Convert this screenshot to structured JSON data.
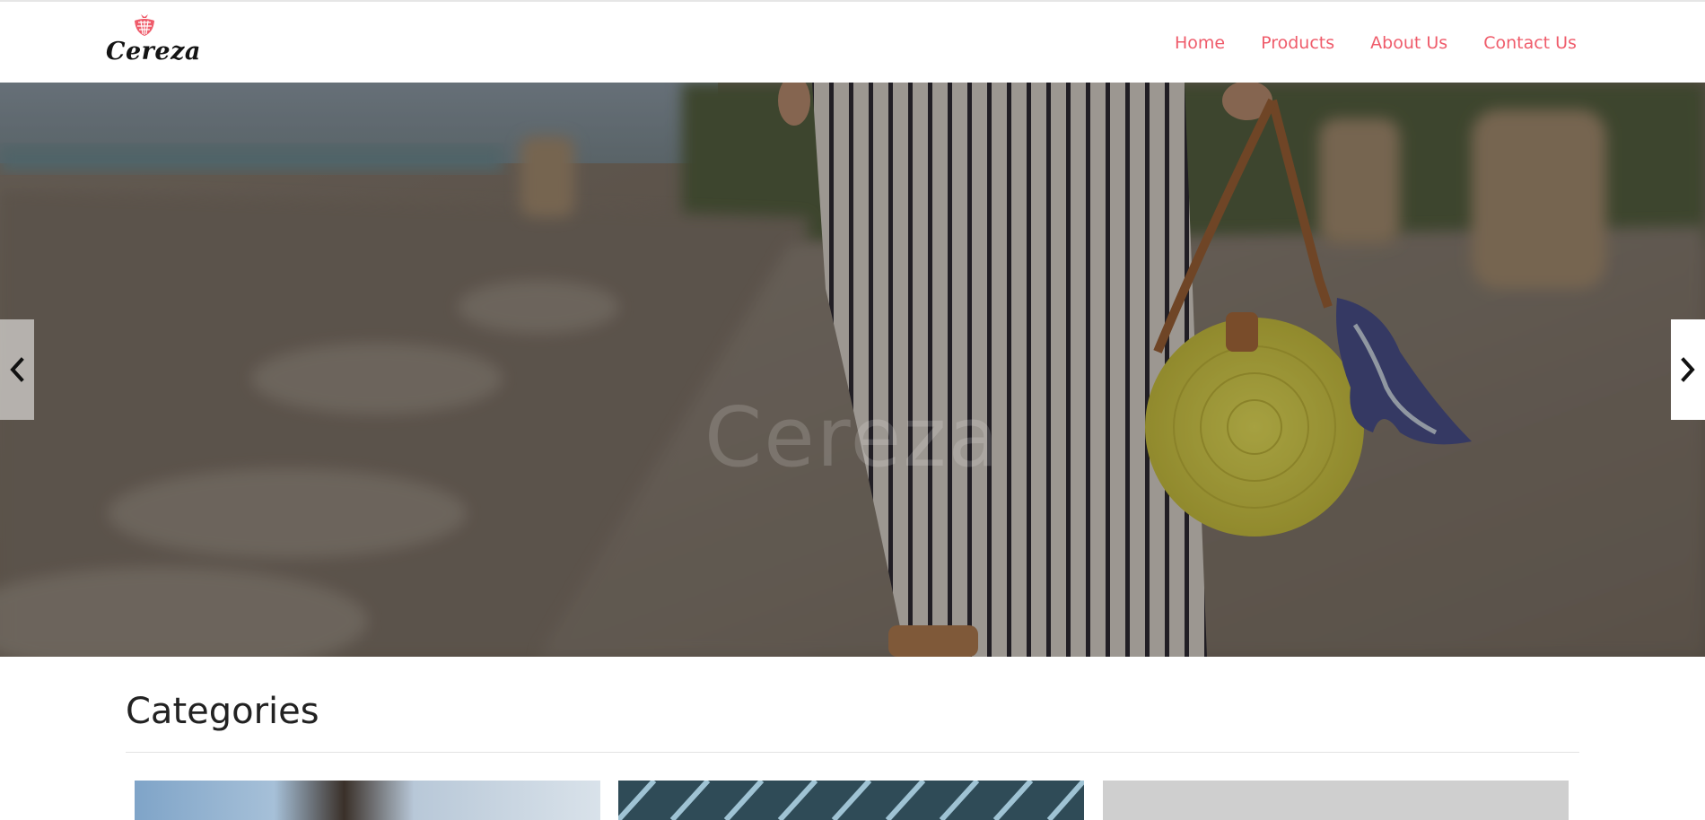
{
  "brand": {
    "name": "Cereza",
    "logo_icon": "strawberry-basket-icon",
    "accent_color": "#ef5c6b"
  },
  "nav": {
    "items": [
      {
        "label": "Home"
      },
      {
        "label": "Products"
      },
      {
        "label": "About Us"
      },
      {
        "label": "Contact Us"
      }
    ]
  },
  "hero": {
    "overlay_text": "Cereza",
    "prev_icon": "chevron-left-icon",
    "next_icon": "chevron-right-icon"
  },
  "categories": {
    "heading": "Categories",
    "cards": [
      {
        "image": "category-image-1"
      },
      {
        "image": "category-image-2"
      },
      {
        "image": "category-image-3"
      }
    ]
  }
}
